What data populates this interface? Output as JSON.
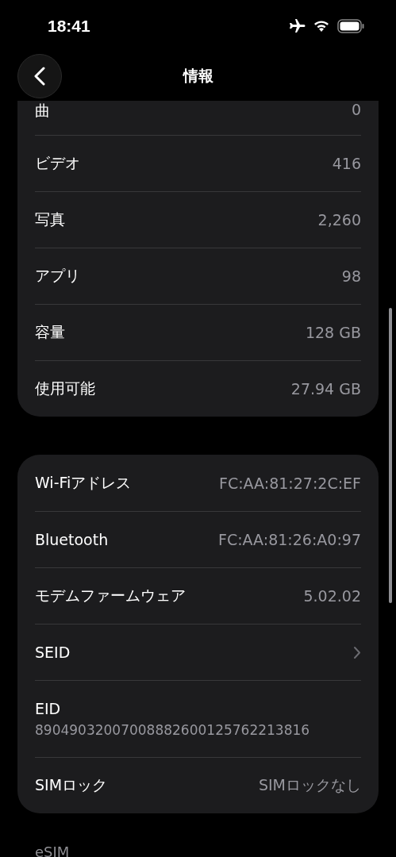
{
  "status_bar": {
    "time": "18:41"
  },
  "nav": {
    "title": "情報"
  },
  "groups": [
    {
      "rows": [
        {
          "kind": "value",
          "label": "曲",
          "value": "0"
        },
        {
          "kind": "value",
          "label": "ビデオ",
          "value": "416"
        },
        {
          "kind": "value",
          "label": "写真",
          "value": "2,260"
        },
        {
          "kind": "value",
          "label": "アプリ",
          "value": "98"
        },
        {
          "kind": "value",
          "label": "容量",
          "value": "128 GB"
        },
        {
          "kind": "value",
          "label": "使用可能",
          "value": "27.94 GB"
        }
      ]
    },
    {
      "rows": [
        {
          "kind": "value",
          "label": "Wi-Fiアドレス",
          "value": "FC:AA:81:27:2C:EF"
        },
        {
          "kind": "value",
          "label": "Bluetooth",
          "value": "FC:AA:81:26:A0:97"
        },
        {
          "kind": "value",
          "label": "モデムファームウェア",
          "value": "5.02.02"
        },
        {
          "kind": "link",
          "label": "SEID"
        },
        {
          "kind": "stacked",
          "label": "EID",
          "value": "89049032007008882600125762213816"
        },
        {
          "kind": "value",
          "label": "SIMロック",
          "value": "SIMロックなし"
        }
      ]
    }
  ],
  "section_header": "eSIM"
}
